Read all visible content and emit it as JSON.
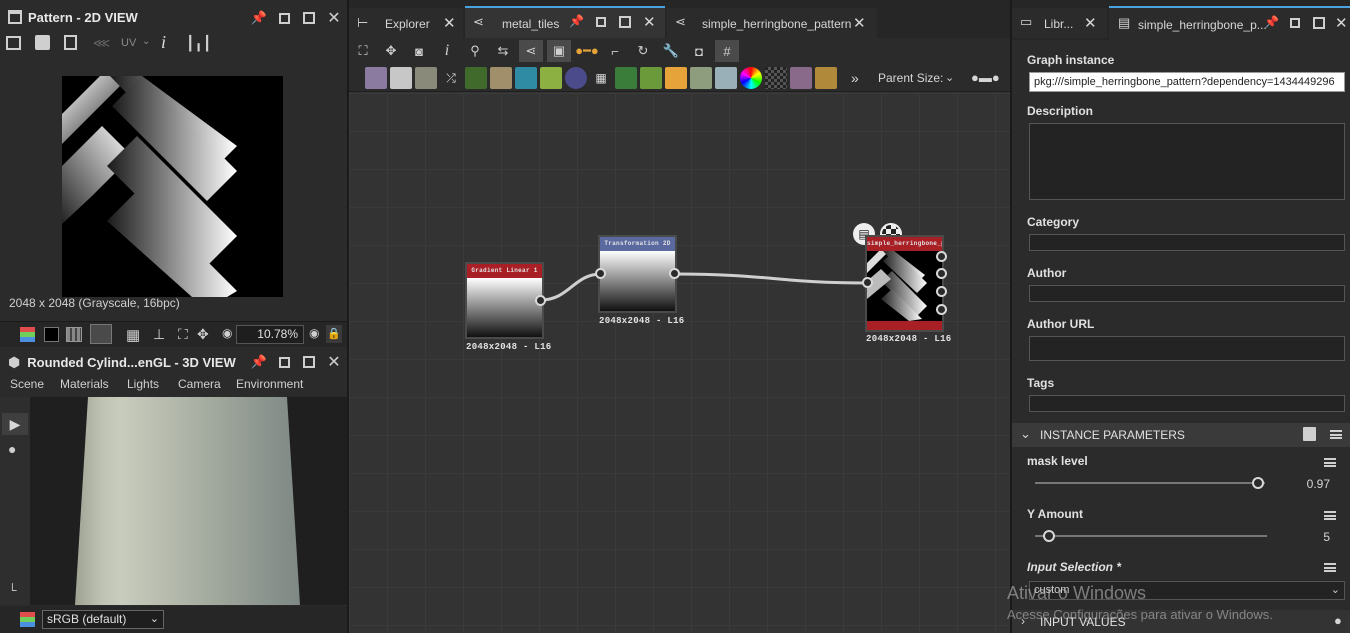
{
  "view2d": {
    "title": "Pattern - 2D VIEW",
    "uv_label": "UV",
    "info": "2048 x 2048 (Grayscale, 16bpc)",
    "zoom": "10.78%"
  },
  "view3d": {
    "title": "Rounded Cylind...enGL - 3D VIEW",
    "menu": [
      "Scene",
      "Materials",
      "Lights",
      "Camera",
      "Environment"
    ],
    "colorspace": "sRGB (default)"
  },
  "graph": {
    "tabs": [
      "Explorer",
      "metal_tiles",
      "simple_herringbone_pattern"
    ],
    "parent_size_label": "Parent Size:",
    "nodes": [
      {
        "title": "Gradient Linear 1",
        "size": "2048x2048 - L16"
      },
      {
        "title": "Transformation 2D",
        "size": "2048x2048 - L16"
      },
      {
        "title": "simple_herringbone_pa...",
        "size": "2048x2048 - L16"
      }
    ]
  },
  "properties": {
    "tabs": [
      "Libr...",
      "simple_herringbone_p..."
    ],
    "graph_instance_label": "Graph instance",
    "graph_instance_value": "pkg:///simple_herringbone_pattern?dependency=1434449296",
    "description_label": "Description",
    "category_label": "Category",
    "author_label": "Author",
    "author_url_label": "Author URL",
    "tags_label": "Tags",
    "instance_params_header": "INSTANCE PARAMETERS",
    "mask_level_label": "mask level",
    "mask_level_value": "0.97",
    "mask_level_fraction": 0.97,
    "y_amount_label": "Y Amount",
    "y_amount_value": "5",
    "y_amount_fraction": 0.06,
    "input_selection_label": "Input Selection *",
    "input_selection_value": "custom",
    "input_values_header": "INPUT VALUES"
  },
  "watermark": {
    "line1": "Ativar o Windows",
    "line2": "Acesse Configurações para ativar o Windows."
  }
}
